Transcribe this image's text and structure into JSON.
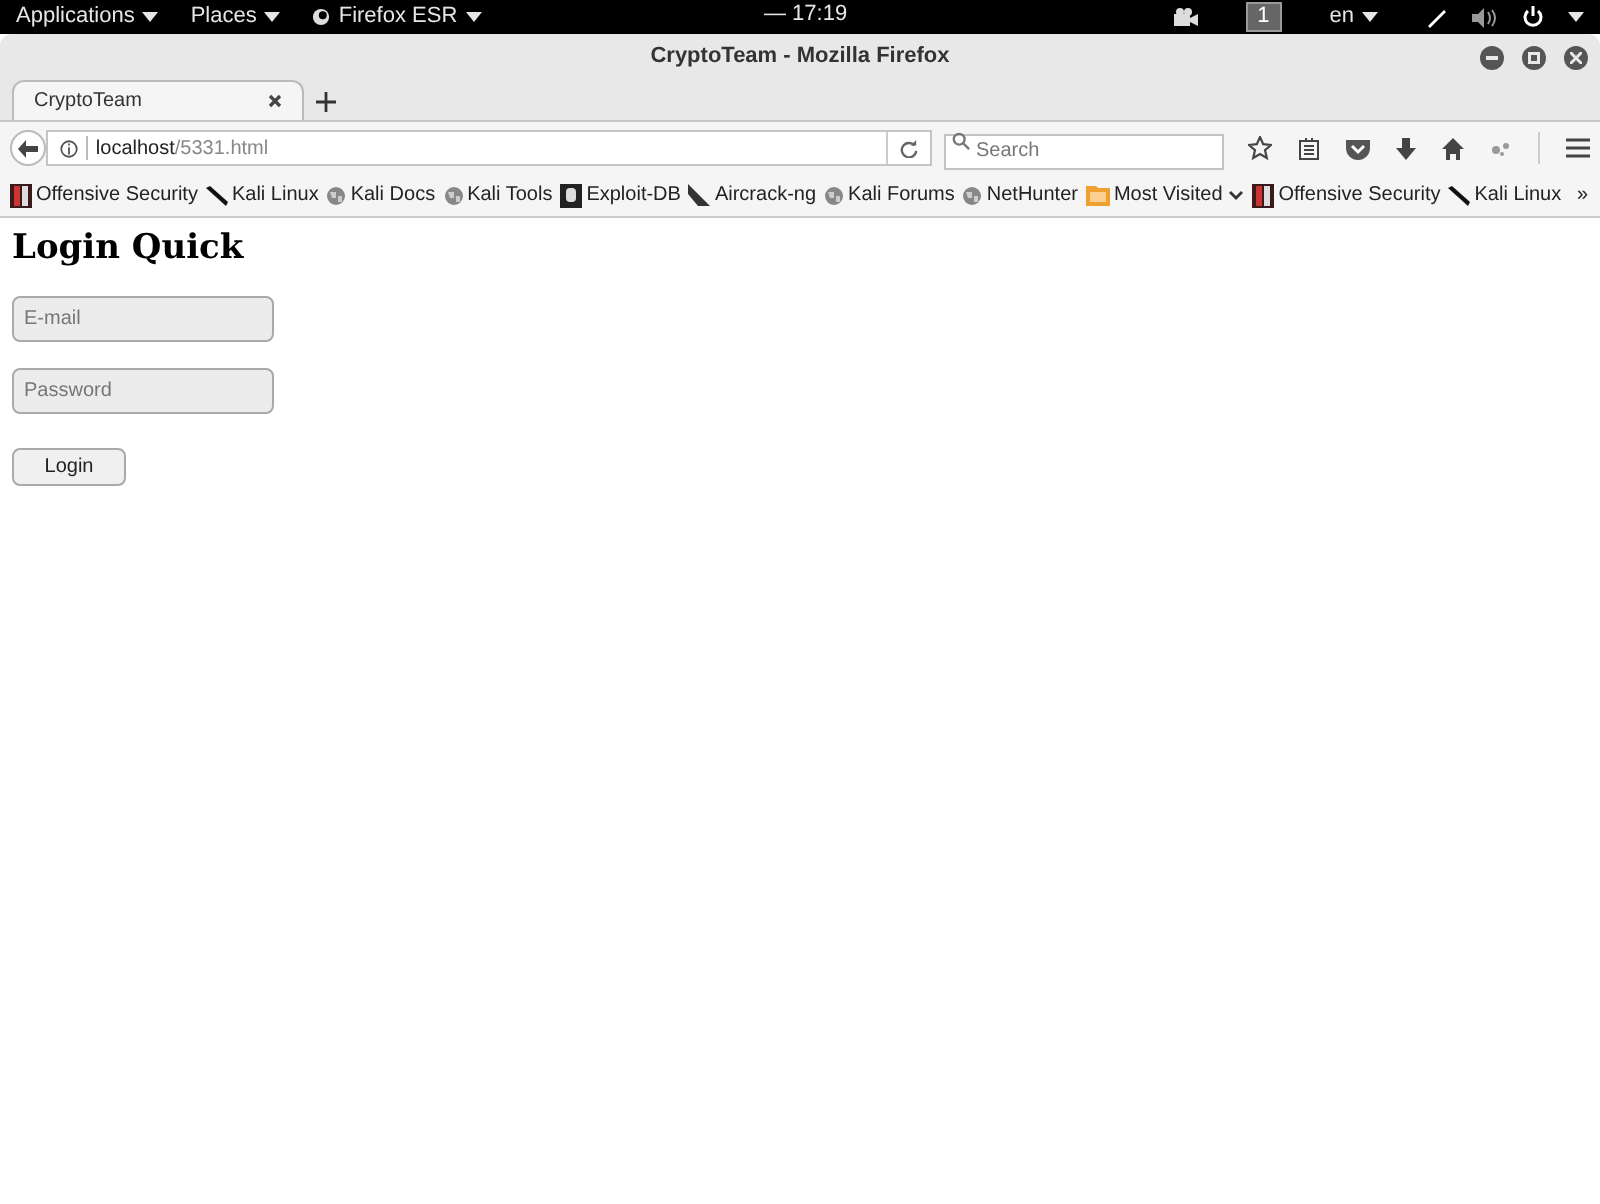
{
  "top_bar": {
    "menus": [
      {
        "label": "Applications",
        "kind": "plain"
      },
      {
        "label": "Places",
        "kind": "plain"
      },
      {
        "label": "Firefox ESR",
        "kind": "app"
      }
    ],
    "clock": "— 17:19",
    "workspace": "1",
    "language": "en"
  },
  "window": {
    "title": "CryptoTeam - Mozilla Firefox"
  },
  "tabs": [
    {
      "label": "CryptoTeam",
      "selected": true
    }
  ],
  "address_bar": {
    "host": "localhost",
    "path": "/5331.html"
  },
  "search": {
    "placeholder": "Search"
  },
  "bookmarks": [
    {
      "label": "Offensive Security",
      "kind": "logo"
    },
    {
      "label": "Kali Linux",
      "kind": "pen"
    },
    {
      "label": "Kali Docs",
      "kind": "globe"
    },
    {
      "label": "Kali Tools",
      "kind": "globe"
    },
    {
      "label": "Exploit-DB",
      "kind": "exploit"
    },
    {
      "label": "Aircrack-ng",
      "kind": "aircrack"
    },
    {
      "label": "Kali Forums",
      "kind": "globe"
    },
    {
      "label": "NetHunter",
      "kind": "globe"
    },
    {
      "label": "Most Visited",
      "kind": "folder"
    },
    {
      "label": "Offensive Security",
      "kind": "logo"
    },
    {
      "label": "Kali Linux",
      "kind": "pen"
    }
  ],
  "overflow": "»",
  "page": {
    "heading": "Login Quick",
    "fields": [
      {
        "placeholder": "E-mail"
      },
      {
        "placeholder": "Password"
      }
    ],
    "button": "Login"
  }
}
